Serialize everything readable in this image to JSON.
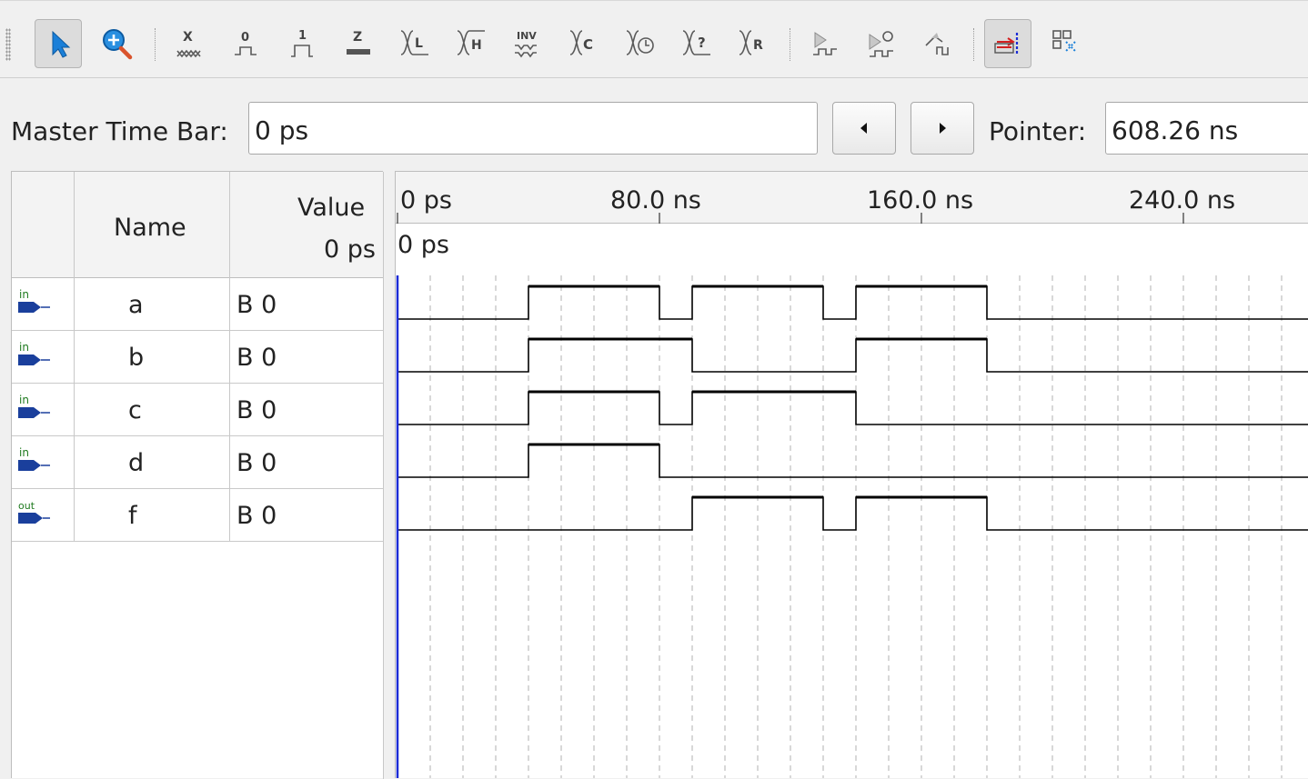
{
  "toolbar": {
    "tools": [
      {
        "name": "selection-tool",
        "pressed": true
      },
      {
        "name": "zoom-tool",
        "pressed": false
      },
      {
        "name": "forcing-unknown",
        "label": "X"
      },
      {
        "name": "force-low",
        "label": "0"
      },
      {
        "name": "force-high",
        "label": "1"
      },
      {
        "name": "force-high-impedance",
        "label": "Z"
      },
      {
        "name": "force-weak-low",
        "label": "L"
      },
      {
        "name": "force-weak-high",
        "label": "H"
      },
      {
        "name": "invert",
        "label": "INV"
      },
      {
        "name": "count-value",
        "label": "C"
      },
      {
        "name": "overwrite-clock",
        "label": "O"
      },
      {
        "name": "random-value",
        "label": "?"
      },
      {
        "name": "random-values",
        "label": "R"
      },
      {
        "name": "run-functional-simulation"
      },
      {
        "name": "run-timing-simulation"
      },
      {
        "name": "generate-netlist"
      },
      {
        "name": "snap-to-grid",
        "pressed": true
      },
      {
        "name": "group-ungroup"
      }
    ]
  },
  "timebar": {
    "master_label": "Master Time Bar:",
    "master_value": "0 ps",
    "pointer_label": "Pointer:",
    "pointer_value": "608.26 ns"
  },
  "grid": {
    "col_name": "Name",
    "col_value": "Value",
    "col_value_sub": "0 ps",
    "signals": [
      {
        "dir": "in",
        "name": "a",
        "value": "B 0"
      },
      {
        "dir": "in",
        "name": "b",
        "value": "B 0"
      },
      {
        "dir": "in",
        "name": "c",
        "value": "B 0"
      },
      {
        "dir": "in",
        "name": "d",
        "value": "B 0"
      },
      {
        "dir": "out",
        "name": "f",
        "value": "B 0"
      }
    ]
  },
  "ruler": {
    "labels": [
      "0 ps",
      "80.0 ns",
      "160.0 ns",
      "240.0 ns"
    ],
    "cursor_label": "0 ps"
  },
  "waveforms": {
    "time_unit": "ns",
    "transition_times_ns": [
      0,
      40,
      80,
      90,
      130,
      140,
      180,
      280
    ],
    "a": [
      0,
      1,
      0,
      1,
      0,
      1,
      0
    ],
    "b": [
      0,
      1,
      1,
      0,
      0,
      1,
      0
    ],
    "c": [
      0,
      1,
      0,
      1,
      1,
      0,
      0
    ],
    "d": [
      0,
      1,
      0,
      0,
      0,
      0,
      0
    ],
    "f": [
      0,
      0,
      0,
      1,
      0,
      1,
      0
    ]
  },
  "colors": {
    "cursor": "#1a2ad6",
    "wave": "#000000",
    "grid": "#b0b0b0",
    "accent_icon": "#1a7fd8"
  }
}
